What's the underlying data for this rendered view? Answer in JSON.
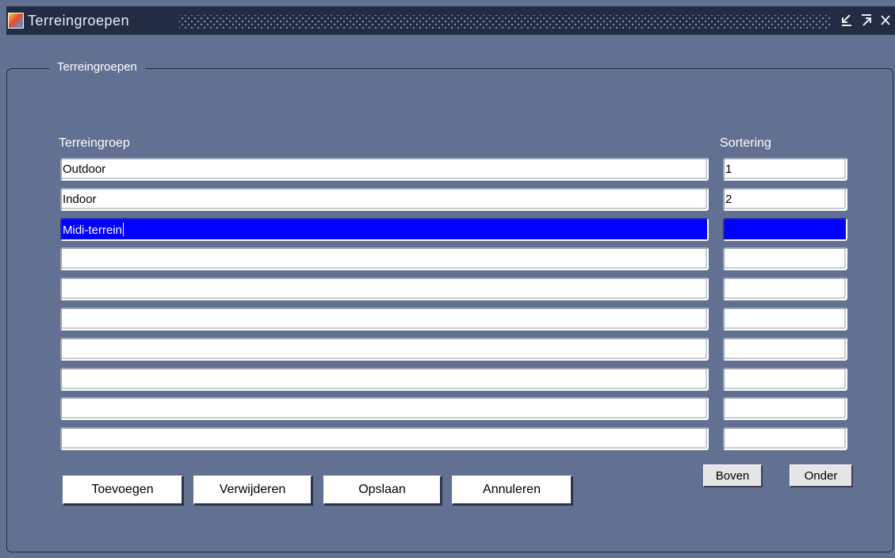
{
  "window": {
    "title": "Terreingroepen",
    "controls": {
      "minimize_icon": "minimize-icon",
      "maximize_icon": "maximize-icon",
      "close_icon": "close-icon"
    }
  },
  "frame": {
    "title": "Terreingroepen"
  },
  "columns": {
    "group": "Terreingroep",
    "sort": "Sortering"
  },
  "rows": [
    {
      "group": "Outdoor",
      "sort": "1"
    },
    {
      "group": "Indoor",
      "sort": "2"
    },
    {
      "group": "Midi-terrein",
      "sort": ""
    },
    {
      "group": "",
      "sort": ""
    },
    {
      "group": "",
      "sort": ""
    },
    {
      "group": "",
      "sort": ""
    },
    {
      "group": "",
      "sort": ""
    },
    {
      "group": "",
      "sort": ""
    },
    {
      "group": "",
      "sort": ""
    },
    {
      "group": "",
      "sort": ""
    }
  ],
  "selected_row": 3,
  "buttons": {
    "add": "Toevoegen",
    "delete": "Verwijderen",
    "save": "Opslaan",
    "cancel": "Annuleren",
    "up": "Boven",
    "down": "Onder"
  },
  "colors": {
    "background": "#627192",
    "titlebar": "#222d44",
    "selection": "#0000ff"
  }
}
